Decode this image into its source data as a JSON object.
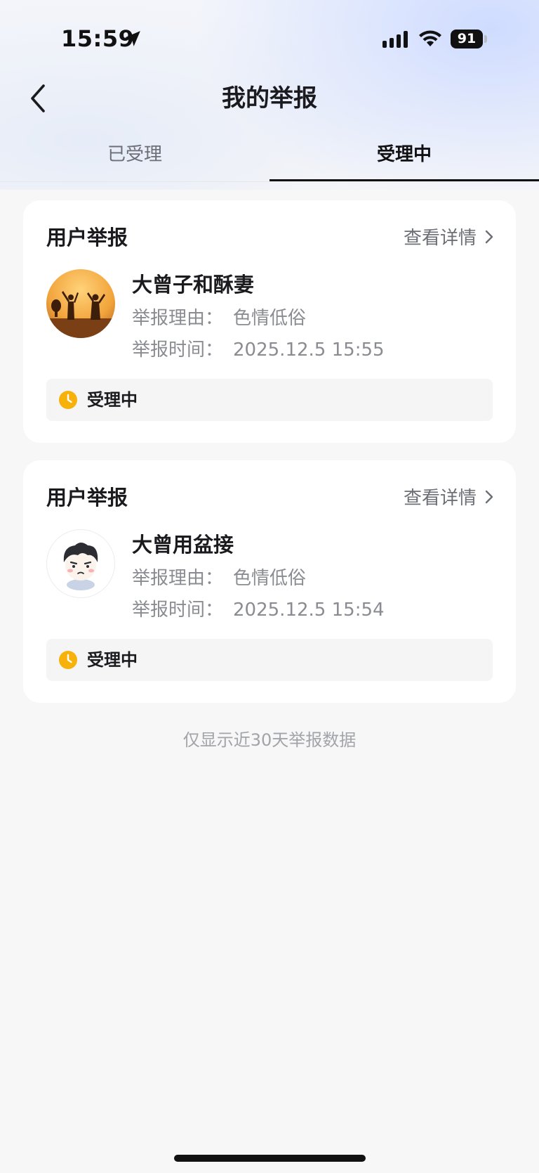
{
  "status_bar": {
    "time": "15:59",
    "battery": "91",
    "icons": [
      "location-arrow-icon",
      "signal-icon",
      "wifi-icon",
      "battery-icon"
    ]
  },
  "nav": {
    "title": "我的举报",
    "back_icon": "chevron-left-icon"
  },
  "tabs": [
    {
      "label": "已受理",
      "active": false
    },
    {
      "label": "受理中",
      "active": true
    }
  ],
  "reports": [
    {
      "type": "用户举报",
      "details_label": "查看详情",
      "user_name": "大曾子和酥妻",
      "reason_label": "举报理由：",
      "reason": "色情低俗",
      "time_label": "举报时间：",
      "time": "2025.12.5 15:55",
      "status": "受理中",
      "status_color": "#f6b10a"
    },
    {
      "type": "用户举报",
      "details_label": "查看详情",
      "user_name": "大曾用盆接",
      "reason_label": "举报理由：",
      "reason": "色情低俗",
      "time_label": "举报时间：",
      "time": "2025.12.5 15:54",
      "status": "受理中",
      "status_color": "#f6b10a"
    }
  ],
  "footer_note": "仅显示近30天举报数据"
}
